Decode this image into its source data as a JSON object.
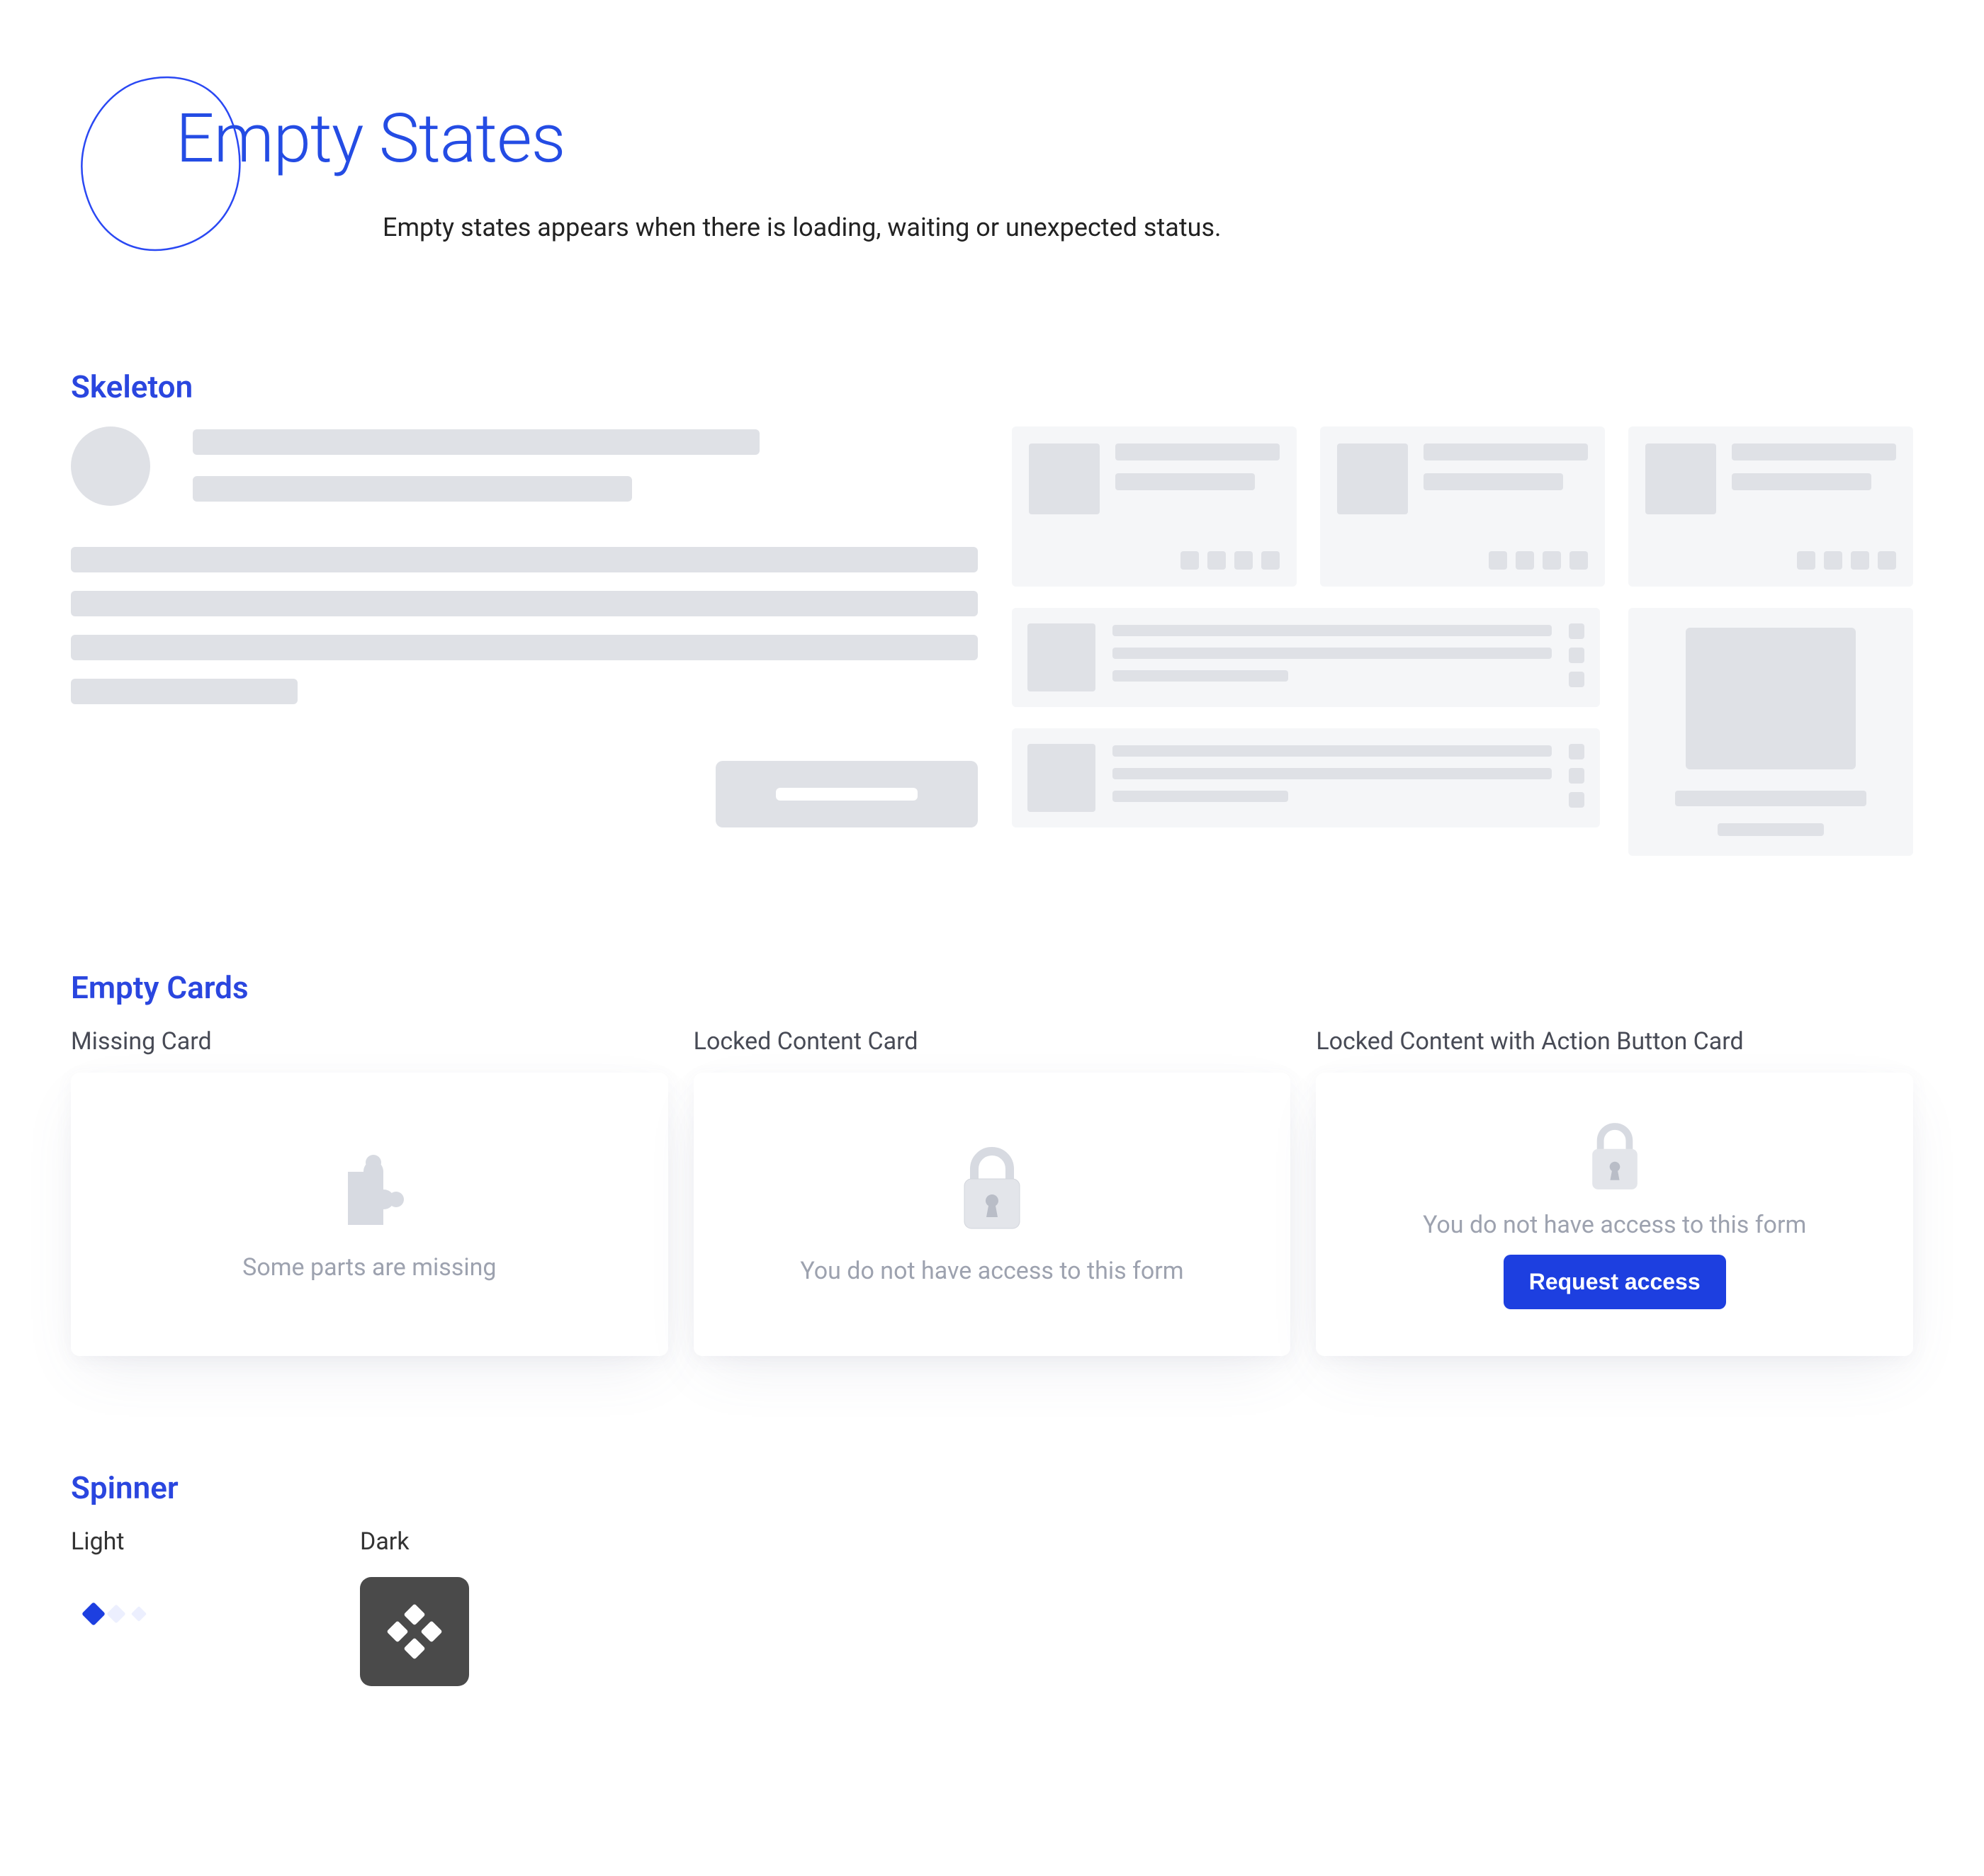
{
  "header": {
    "title": "Empty States",
    "subtitle": "Empty states appears when there is loading, waiting or unexpected status."
  },
  "sections": {
    "skeleton_title": "Skeleton",
    "empty_cards_title": "Empty Cards",
    "spinner_title": "Spinner"
  },
  "empty_cards": {
    "missing": {
      "label": "Missing Card",
      "text": "Some parts are missing",
      "icon": "puzzle-piece-icon"
    },
    "locked": {
      "label": "Locked Content Card",
      "text": "You do not have access to this form",
      "icon": "lock-icon"
    },
    "locked_action": {
      "label": "Locked Content with Action Button Card",
      "text": "You do not have access to this form",
      "icon": "lock-icon",
      "button_label": "Request access"
    }
  },
  "spinner": {
    "light_label": "Light",
    "dark_label": "Dark"
  },
  "colors": {
    "accent": "#1d3fe0",
    "skeleton_bg": "#f5f6f8",
    "skeleton_element": "#dfe1e6",
    "dark_tile": "#4a4a4a"
  }
}
